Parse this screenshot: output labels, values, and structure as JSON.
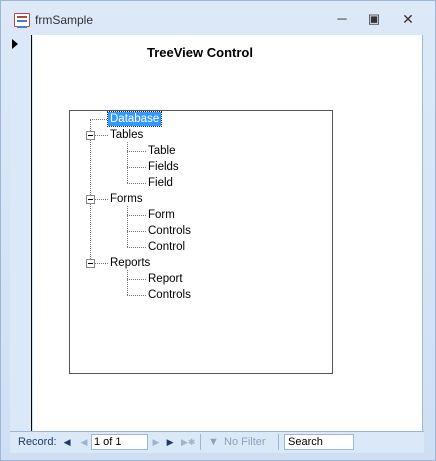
{
  "window": {
    "title": "frmSample",
    "minimize_label": "▭",
    "maximize_label": "▢",
    "close_label": "✕"
  },
  "form": {
    "title": "TreeView Control"
  },
  "tree": {
    "root": "Database",
    "groups": [
      {
        "label": "Tables",
        "children": [
          "Table",
          "Fields",
          "Field"
        ]
      },
      {
        "label": "Forms",
        "children": [
          "Form",
          "Controls",
          "Control"
        ]
      },
      {
        "label": "Reports",
        "children": [
          "Report",
          "Controls"
        ]
      }
    ]
  },
  "navigation": {
    "record_label": "Record:",
    "position": "1 of 1",
    "filter_label": "No Filter",
    "search_placeholder": "Search",
    "first_icon": "first-record-icon",
    "prev_icon": "previous-record-icon",
    "next_icon": "next-record-icon",
    "last_icon": "last-record-icon",
    "new_icon": "new-record-icon",
    "filter_icon": "filter-icon"
  }
}
